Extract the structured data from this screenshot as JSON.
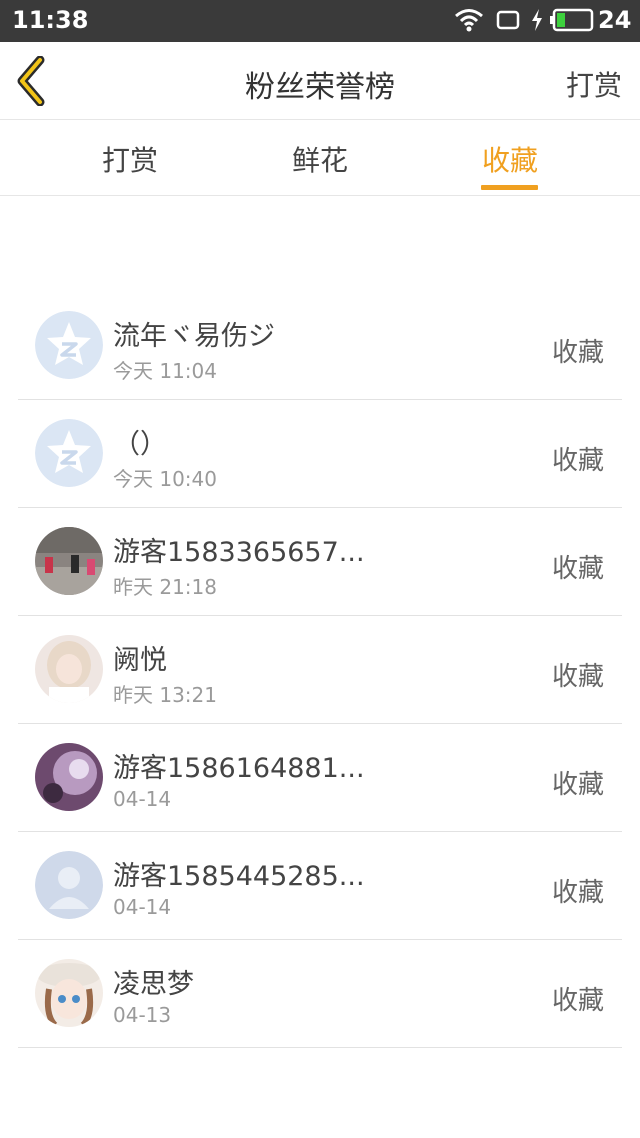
{
  "status_bar": {
    "time": "11:38",
    "battery_level": "24"
  },
  "header": {
    "title": "粉丝荣誉榜",
    "right_action": "打赏"
  },
  "tabs": [
    {
      "label": "打赏",
      "active": false
    },
    {
      "label": "鲜花",
      "active": false
    },
    {
      "label": "收藏",
      "active": true
    }
  ],
  "colors": {
    "accent": "#f0a020",
    "text": "#444444",
    "subtext": "#9a9a9a"
  },
  "rows": [
    {
      "name": "流年ヾ易伤ジ",
      "time": "今天 11:04",
      "action": "收藏",
      "avatar": "qzone-default-icon"
    },
    {
      "name": "（）",
      "time": "今天 10:40",
      "action": "收藏",
      "avatar": "qzone-default-icon"
    },
    {
      "name": "游客1583365657...",
      "time": "昨天 21:18",
      "action": "收藏",
      "avatar": "photo-street-avatar"
    },
    {
      "name": "阙悦",
      "time": "昨天 13:21",
      "action": "收藏",
      "avatar": "photo-girl-avatar"
    },
    {
      "name": "游客1586164881...",
      "time": "04-14",
      "action": "收藏",
      "avatar": "photo-purple-avatar"
    },
    {
      "name": "游客1585445285...",
      "time": "04-14",
      "action": "收藏",
      "avatar": "default-person-icon"
    },
    {
      "name": "凌思梦",
      "time": "04-13",
      "action": "收藏",
      "avatar": "anime-girl-avatar"
    }
  ]
}
